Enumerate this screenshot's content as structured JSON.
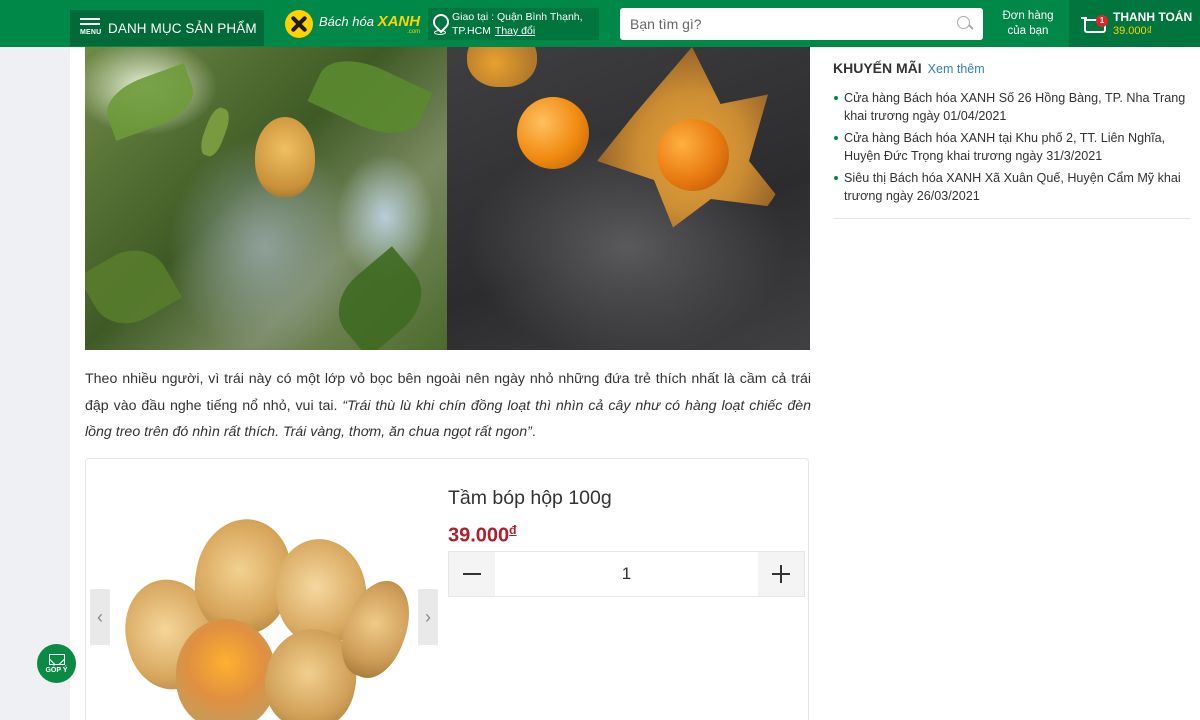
{
  "header": {
    "menu_label": "DANH MỤC SẢN PHẨM",
    "menu_small": "MENU",
    "logo_word1": "Bách hóa",
    "logo_word2": "XANH",
    "logo_sub": ".com",
    "location_line1": "Giao tại : Quận Bình Thạnh,",
    "location_city": "TP.HCM",
    "location_change": "Thay đổi",
    "search_placeholder": "Bạn tìm gì?",
    "orders_line1": "Đơn hàng",
    "orders_line2": "của bạn",
    "cart_badge": "1",
    "cart_label": "THANH TOÁN",
    "cart_total": "39.000₫"
  },
  "article": {
    "para_plain": "Theo nhiều người, vì trái này có một lớp vỏ bọc bên ngoài nên ngày nhỏ những đứa trẻ thích nhất là cầm cả trái đập vào đầu nghe tiếng nổ nhỏ, vui tai. ",
    "para_quote": "“Trái thù lù khi chín đồng loạt thì nhìn cả cây như có hàng loạt chiếc đèn lồng treo trên đó nhìn rất thích. Trái vàng, thơm, ăn chua ngọt rất ngon”",
    "para_end": "."
  },
  "product": {
    "name": "Tầm bóp hộp 100g",
    "price": "39.000",
    "currency": "đ",
    "quantity": "1",
    "prev_arrow": "‹",
    "next_arrow": "›"
  },
  "sidebar": {
    "title": "KHUYẾN MÃI",
    "more": "Xem thêm",
    "items": [
      "Cửa hàng Bách hóa XANH Số 26 Hồng Bàng, TP. Nha Trang khai trương ngày 01/04/2021",
      "Cửa hàng Bách hóa XANH tại Khu phố 2, TT. Liên Nghĩa, Huyện Đức Trọng khai trương ngày 31/3/2021",
      "Siêu thị Bách hóa XANH Xã Xuân Quế, Huyện Cẩm Mỹ khai trương ngày 26/03/2021"
    ]
  },
  "feedback": {
    "label": "GÓP Ý"
  },
  "colors": {
    "brand_green": "#008848",
    "price_red": "#b01f2c",
    "link_blue": "#2f80c0",
    "accent_yellow": "#ffd200"
  }
}
